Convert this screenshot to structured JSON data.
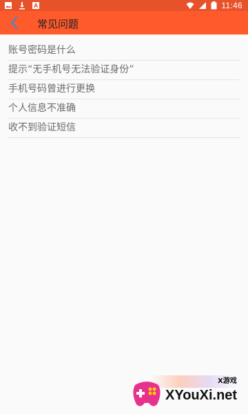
{
  "status_bar": {
    "time": "11:46",
    "icons": [
      "image-icon",
      "download-icon",
      "a-icon",
      "wifi-icon",
      "signal-icon",
      "battery-icon"
    ]
  },
  "app_bar": {
    "title": "常见问题",
    "back_icon": "chevron-left-icon"
  },
  "faq": {
    "items": [
      "账号密码是什么",
      "提示“无手机号无法验证身份”",
      "手机号码曾进行更换",
      "个人信息不准确",
      "收不到验证短信"
    ]
  },
  "watermark": {
    "text": "XYouXi.net",
    "subtext": "X游戏"
  },
  "colors": {
    "status_bar": "#e7522b",
    "app_bar": "#ff5a2c",
    "background": "#fafafa"
  }
}
